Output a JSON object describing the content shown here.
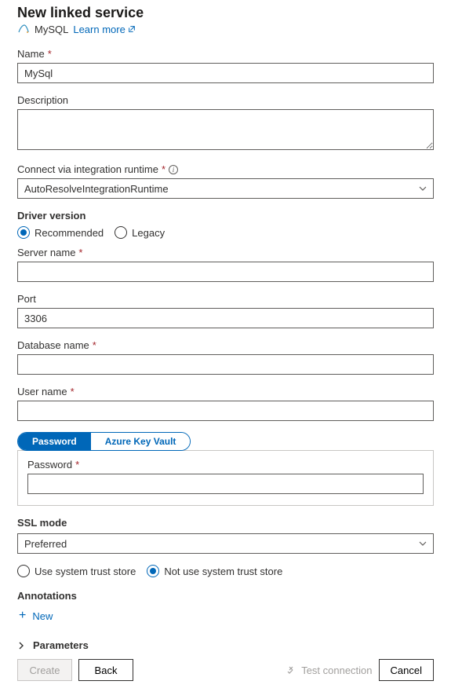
{
  "header": {
    "title": "New linked service",
    "service": "MySQL",
    "learnMore": "Learn more"
  },
  "name": {
    "label": "Name",
    "value": "MySql"
  },
  "description": {
    "label": "Description",
    "value": ""
  },
  "runtime": {
    "label": "Connect via integration runtime",
    "value": "AutoResolveIntegrationRuntime"
  },
  "driver": {
    "label": "Driver version",
    "recommended": "Recommended",
    "legacy": "Legacy"
  },
  "server": {
    "label": "Server name",
    "value": ""
  },
  "port": {
    "label": "Port",
    "value": "3306"
  },
  "database": {
    "label": "Database name",
    "value": ""
  },
  "user": {
    "label": "User name",
    "value": ""
  },
  "pwTabs": {
    "password": "Password",
    "akv": "Azure Key Vault"
  },
  "password": {
    "label": "Password",
    "value": ""
  },
  "ssl": {
    "label": "SSL mode",
    "value": "Preferred"
  },
  "trust": {
    "use": "Use system trust store",
    "notUse": "Not use system trust store"
  },
  "annotations": {
    "label": "Annotations",
    "new": "New"
  },
  "parameters": {
    "label": "Parameters"
  },
  "footer": {
    "create": "Create",
    "back": "Back",
    "test": "Test connection",
    "cancel": "Cancel"
  }
}
